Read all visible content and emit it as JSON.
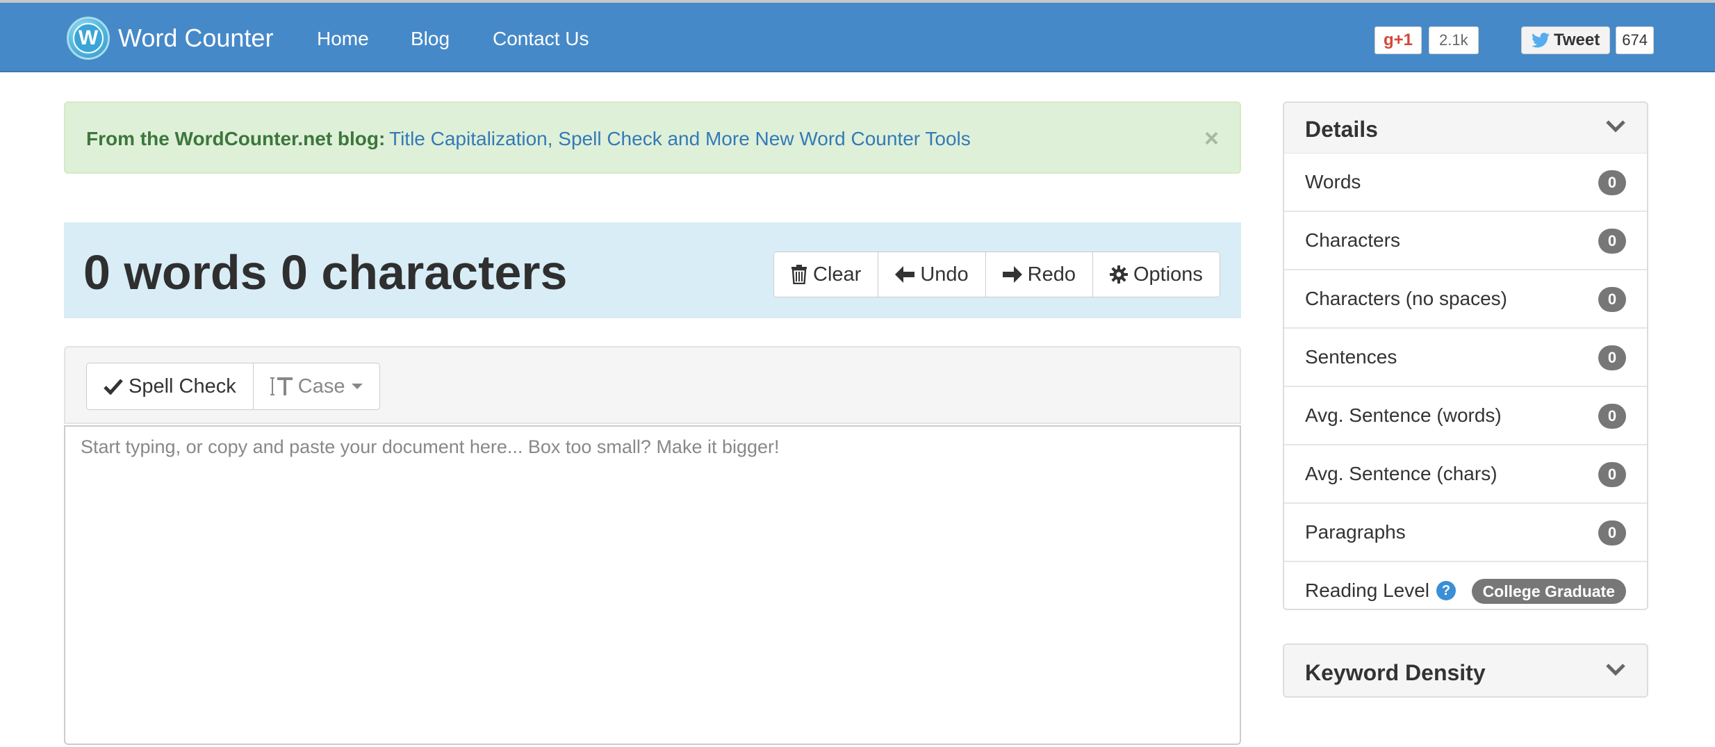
{
  "header": {
    "brand_letter": "W",
    "brand_name": "Word Counter",
    "nav": [
      "Home",
      "Blog",
      "Contact Us"
    ],
    "gplus_label": "g+1",
    "gplus_count": "2.1k",
    "tweet_label": "Tweet",
    "tweet_count": "674"
  },
  "alert": {
    "label": "From the WordCounter.net blog:",
    "link": "Title Capitalization, Spell Check and More New Word Counter Tools",
    "close": "×"
  },
  "counter": {
    "title": "0 words 0 characters",
    "buttons": {
      "clear": "Clear",
      "undo": "Undo",
      "redo": "Redo",
      "options": "Options"
    }
  },
  "toolbar": {
    "spell_check": "Spell Check",
    "case": "Case"
  },
  "editor": {
    "value": "",
    "placeholder": "Start typing, or copy and paste your document here... Box too small? Make it bigger!"
  },
  "details": {
    "title": "Details",
    "stats": [
      {
        "label": "Words",
        "value": "0"
      },
      {
        "label": "Characters",
        "value": "0"
      },
      {
        "label": "Characters (no spaces)",
        "value": "0"
      },
      {
        "label": "Sentences",
        "value": "0"
      },
      {
        "label": "Avg. Sentence (words)",
        "value": "0"
      },
      {
        "label": "Avg. Sentence (chars)",
        "value": "0"
      },
      {
        "label": "Paragraphs",
        "value": "0"
      }
    ],
    "reading_level": {
      "label": "Reading Level",
      "help": "?",
      "value": "College Graduate"
    }
  },
  "keyword_density": {
    "title": "Keyword Density"
  },
  "colors": {
    "navbar": "#4689c8",
    "alert_bg": "#dff0d8",
    "alert_text": "#3c763d",
    "link": "#337ab7",
    "count_bg": "#d9edf7",
    "badge": "#777777"
  }
}
